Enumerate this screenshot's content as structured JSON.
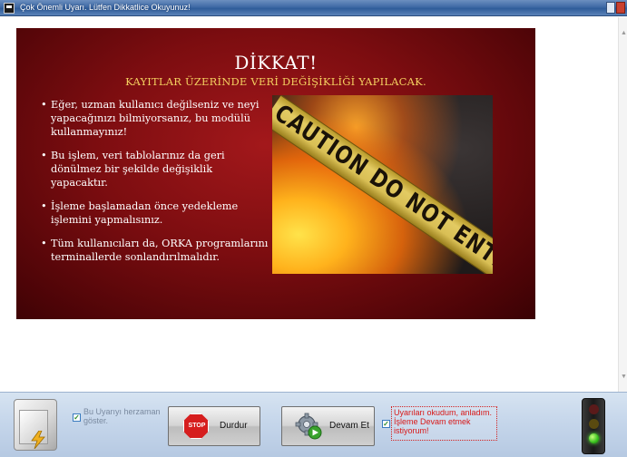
{
  "window": {
    "title": "Çok Önemli Uyarı. Lütfen Dikkatlice Okuyunuz!"
  },
  "slide": {
    "title": "DİKKAT!",
    "subtitle": "KAYITLAR ÜZERİNDE VERİ DEĞİŞİKLİĞİ YAPILACAK.",
    "bullets": [
      "Eğer, uzman kullanıcı değilseniz ve neyi yapacağınızı bilmiyorsanız, bu modülü kullanmayınız!",
      "Bu işlem, veri tablolarınız da geri dönülmez bir şekilde değişiklik yapacaktır.",
      "İşleme başlamadan önce yedekleme işlemini yapmalısınız.",
      "Tüm kullanıcıları da, ORKA programlarını terminallerde sonlandırılmalıdır."
    ],
    "image_text": "CAUTION DO NOT ENTER"
  },
  "footer": {
    "show_warning_label": "Bu Uyarıyı herzaman göster.",
    "show_warning_checked": true,
    "stop_button": {
      "icon_label": "STOP",
      "label": "Durdur"
    },
    "continue_button": {
      "label": "Devam Et"
    },
    "agree_checked": true,
    "agree_text": "Uyarıları okudum, anladım. İşleme Devam etmek istiyorum!"
  },
  "colors": {
    "slide_bg": "#7c0d10",
    "subtitle": "#f4d060",
    "agree_text": "#d81818",
    "titlebar": "#3f6aa6"
  },
  "icons": {
    "app": "app-window-icon",
    "safe": "safe-icon",
    "stop": "stop-sign-icon",
    "continue": "gear-play-icon",
    "status": "traffic-light-icon"
  }
}
